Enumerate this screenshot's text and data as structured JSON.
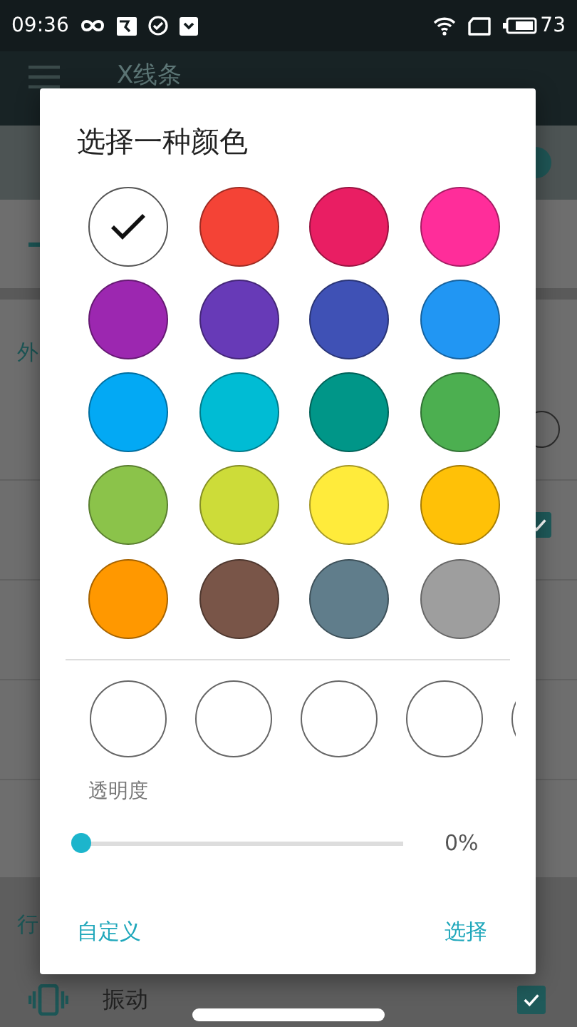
{
  "status_bar": {
    "time": "09:36",
    "battery": "73"
  },
  "toolbar": {
    "title": "X线条"
  },
  "background": {
    "section_1": "外",
    "section_2": "行",
    "vibrate_row": {
      "label": "振动",
      "checked": true
    },
    "right_checkbox": {
      "checked": true
    }
  },
  "dialog": {
    "title": "选择一种颜色",
    "colors": [
      {
        "color": "#ffffff",
        "selected": true
      },
      {
        "color": "#f44336",
        "selected": false
      },
      {
        "color": "#e91e63",
        "selected": false
      },
      {
        "color": "#ff2d9a",
        "selected": false
      },
      {
        "color": "#9c27b0",
        "selected": false
      },
      {
        "color": "#673ab7",
        "selected": false
      },
      {
        "color": "#3f51b5",
        "selected": false
      },
      {
        "color": "#2196f3",
        "selected": false
      },
      {
        "color": "#03a9f4",
        "selected": false
      },
      {
        "color": "#00bcd4",
        "selected": false
      },
      {
        "color": "#009688",
        "selected": false
      },
      {
        "color": "#4caf50",
        "selected": false
      },
      {
        "color": "#8bc34a",
        "selected": false
      },
      {
        "color": "#cddc39",
        "selected": false
      },
      {
        "color": "#ffeb3b",
        "selected": false
      },
      {
        "color": "#ffc107",
        "selected": false
      },
      {
        "color": "#ff9800",
        "selected": false
      },
      {
        "color": "#795548",
        "selected": false
      },
      {
        "color": "#607d8b",
        "selected": false
      },
      {
        "color": "#9e9e9e",
        "selected": false
      }
    ],
    "recent": [
      {
        "kind": "empty"
      },
      {
        "kind": "empty"
      },
      {
        "kind": "empty"
      },
      {
        "kind": "empty"
      },
      {
        "kind": "empty"
      }
    ],
    "opacity": {
      "label": "透明度",
      "level": 0,
      "reading": "0%"
    },
    "buttons": [
      {
        "kind": "left",
        "label": "自定义"
      },
      {
        "kind": "right",
        "label": "选择"
      }
    ]
  }
}
